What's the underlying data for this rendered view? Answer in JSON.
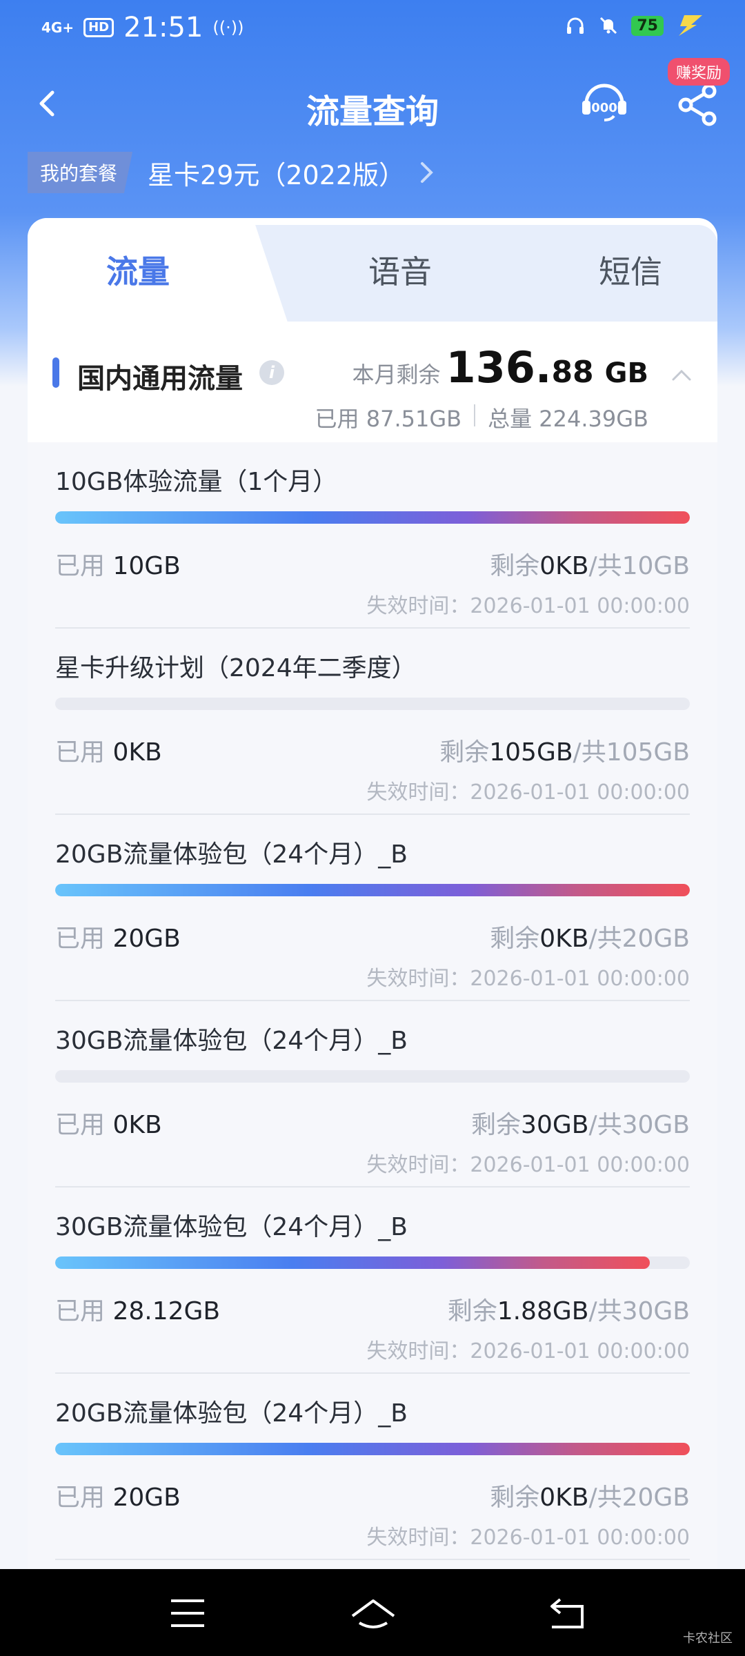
{
  "status_bar": {
    "signal": "4G+",
    "hd": "HD",
    "time": "21:51",
    "battery": "75"
  },
  "header": {
    "title": "流量查询",
    "reward_badge": "赚奖励",
    "service_icon": "10000-service-icon",
    "share_icon": "share-icon"
  },
  "package": {
    "tag": "我的套餐",
    "name": "星卡29元（2022版）"
  },
  "tabs": [
    {
      "label": "流量",
      "active": true
    },
    {
      "label": "语音",
      "active": false
    },
    {
      "label": "短信",
      "active": false
    }
  ],
  "section": {
    "title": "国内通用流量",
    "remain_label": "本月剩余",
    "remain_int": "136.",
    "remain_dec": "88",
    "remain_unit": "GB",
    "used_text": "已用 87.51GB",
    "total_text": "总量 224.39GB"
  },
  "labels": {
    "used": "已用",
    "remain": "剩余",
    "slash": "/"
  },
  "items": [
    {
      "name": "10GB体验流量（1个月）",
      "used": "10GB",
      "remain": "0KB",
      "total": "共10GB",
      "expire": "失效时间：2026-01-01 00:00:00",
      "progress": 1.0
    },
    {
      "name": "星卡升级计划（2024年二季度）",
      "used": "0KB",
      "remain": "105GB",
      "total": "共105GB",
      "expire": "失效时间：2026-01-01 00:00:00",
      "progress": 0.0
    },
    {
      "name": "20GB流量体验包（24个月）_B",
      "used": "20GB",
      "remain": "0KB",
      "total": "共20GB",
      "expire": "失效时间：2026-01-01 00:00:00",
      "progress": 1.0
    },
    {
      "name": "30GB流量体验包（24个月）_B",
      "used": "0KB",
      "remain": "30GB",
      "total": "共30GB",
      "expire": "失效时间：2026-01-01 00:00:00",
      "progress": 0.0
    },
    {
      "name": "30GB流量体验包（24个月）_B",
      "used": "28.12GB",
      "remain": "1.88GB",
      "total": "共30GB",
      "expire": "失效时间：2026-01-01 00:00:00",
      "progress": 0.9373
    },
    {
      "name": "20GB流量体验包（24个月）_B",
      "used": "20GB",
      "remain": "0KB",
      "total": "共20GB",
      "expire": "失效时间：2026-01-01 00:00:00",
      "progress": 1.0
    }
  ],
  "watermark": "卡农社区",
  "colors": {
    "accent": "#4a78e8",
    "header_blue": "#3d7ff0",
    "badge": "#f0506e",
    "progress_end": "#f0505a"
  }
}
